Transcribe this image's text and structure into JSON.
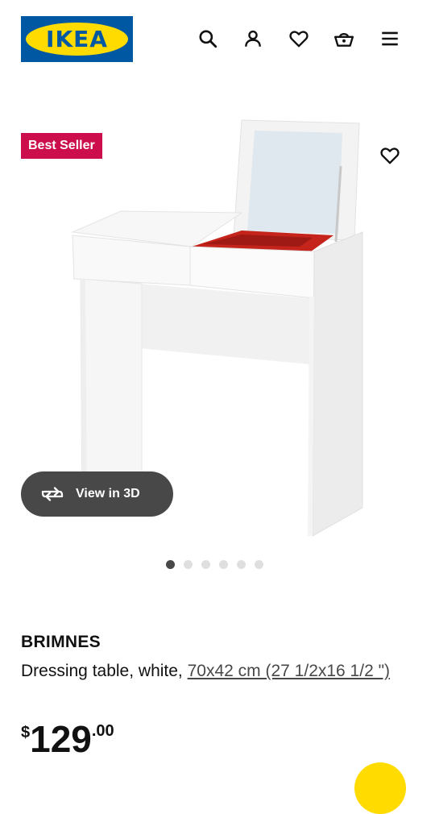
{
  "header": {
    "logo_text": "IKEA",
    "icons": [
      "search-icon",
      "account-icon",
      "favourites-icon",
      "basket-icon",
      "menu-icon"
    ]
  },
  "gallery": {
    "badge": "Best Seller",
    "view_3d_label": "View in 3D",
    "image_count": 6,
    "active_image": 1,
    "image_alt": "BRIMNES dressing table, white, with flip-up mirror and red storage tray"
  },
  "product": {
    "name": "BRIMNES",
    "description": "Dressing table, white, ",
    "size_link": "70x42 cm (27 1/2x16 1/2 \")",
    "price": {
      "currency": "$",
      "integer": "129",
      "decimal": ".00"
    }
  },
  "colors": {
    "ikea_blue": "#0058a3",
    "ikea_yellow": "#ffdb00",
    "badge_red": "#cc0e4c",
    "button_dark": "#484848"
  }
}
